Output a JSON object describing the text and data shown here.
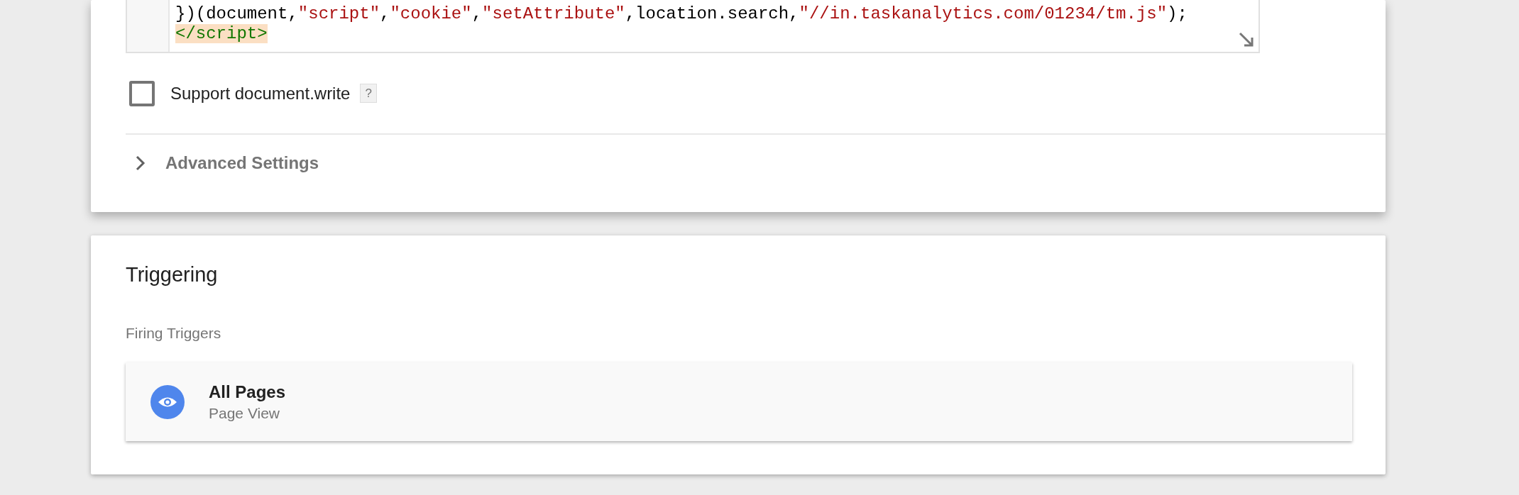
{
  "code_editor": {
    "lines": [
      {
        "tokens": [
          {
            "kind": "plain",
            "text": "})(document,"
          },
          {
            "kind": "string",
            "text": "\"script\""
          },
          {
            "kind": "plain",
            "text": ","
          },
          {
            "kind": "string",
            "text": "\"cookie\""
          },
          {
            "kind": "plain",
            "text": ","
          },
          {
            "kind": "string",
            "text": "\"setAttribute\""
          },
          {
            "kind": "plain",
            "text": ",location.search,"
          },
          {
            "kind": "string",
            "text": "\"//in.taskanalytics.com/01234/tm.js\""
          },
          {
            "kind": "plain",
            "text": ");"
          }
        ]
      },
      {
        "tokens": [
          {
            "kind": "tag",
            "text": "</script>"
          }
        ]
      }
    ]
  },
  "support_document_write": {
    "label": "Support document.write",
    "checked": false,
    "help": "?"
  },
  "advanced_settings": {
    "label": "Advanced Settings",
    "expanded": false
  },
  "triggering": {
    "title": "Triggering",
    "subtitle": "Firing Triggers",
    "triggers": [
      {
        "name": "All Pages",
        "type": "Page View"
      }
    ]
  }
}
